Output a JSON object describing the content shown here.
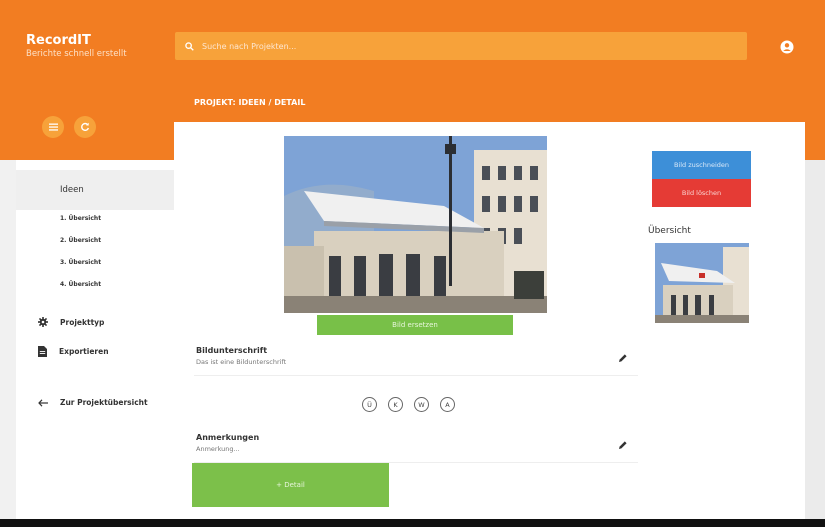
{
  "app": {
    "title": "RecordIT",
    "subtitle": "Berichte schnell erstellt"
  },
  "search": {
    "placeholder": "Suche nach Projekten..."
  },
  "breadcrumb": "PROJEKT: IDEEN / DETAIL",
  "sidebar": {
    "section_label": "Ideen",
    "sub_items": [
      "1. Übersicht",
      "2. Übersicht",
      "3. Übersicht",
      "4. Übersicht"
    ],
    "project_type": "Projekttyp",
    "export": "Exportieren",
    "back": "Zur Projektübersicht"
  },
  "main": {
    "replace_image": "Bild ersetzen",
    "caption": {
      "label": "Bildunterschrift",
      "value": "Das ist eine Bildunterschrift"
    },
    "markers": [
      "Ü",
      "K",
      "W",
      "A"
    ],
    "notes": {
      "label": "Anmerkungen",
      "placeholder": "Anmerkung..."
    },
    "add_detail": "+ Detail"
  },
  "side_panel": {
    "crop_image": "Bild zuschneiden",
    "delete_image": "Bild löschen",
    "overview_title": "Übersicht"
  },
  "colors": {
    "header": "#f27d22",
    "search_bg": "#f7a23a",
    "green": "#7cc04a",
    "blue": "#3d8fd8",
    "red": "#e53b35"
  }
}
